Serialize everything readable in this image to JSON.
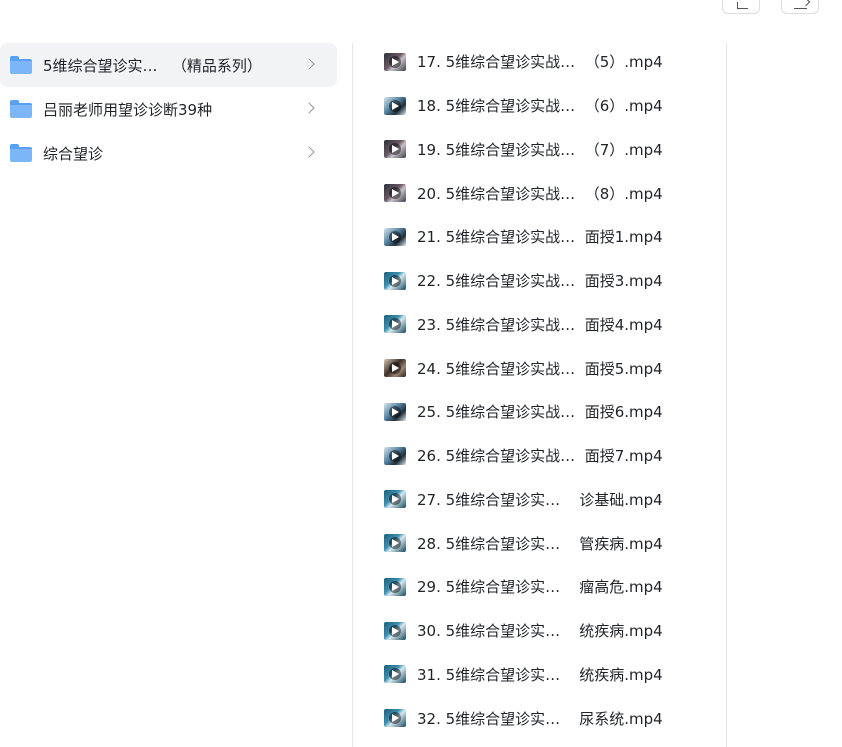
{
  "folders": [
    {
      "name": "5维综合望诊实…   （精品系列）",
      "selected": true
    },
    {
      "name": "吕丽老师用望诊诊断39种",
      "selected": false
    },
    {
      "name": "综合望诊",
      "selected": false
    }
  ],
  "files": [
    {
      "name": "17. 5维综合望诊实战…  （5）.mp4",
      "thumb": "t1"
    },
    {
      "name": "18. 5维综合望诊实战…  （6）.mp4",
      "thumb": "t2"
    },
    {
      "name": "19. 5维综合望诊实战…  （7）.mp4",
      "thumb": "t1"
    },
    {
      "name": "20. 5维综合望诊实战…  （8）.mp4",
      "thumb": "t1"
    },
    {
      "name": "21. 5维综合望诊实战…  面授1.mp4",
      "thumb": "t2"
    },
    {
      "name": "22. 5维综合望诊实战…  面授3.mp4",
      "thumb": "t3"
    },
    {
      "name": "23. 5维综合望诊实战…  面授4.mp4",
      "thumb": "t3"
    },
    {
      "name": "24. 5维综合望诊实战…  面授5.mp4",
      "thumb": "t4"
    },
    {
      "name": "25. 5维综合望诊实战…  面授6.mp4",
      "thumb": "t2"
    },
    {
      "name": "26. 5维综合望诊实战…  面授7.mp4",
      "thumb": "t2"
    },
    {
      "name": "27. 5维综合望诊实…    诊基础.mp4",
      "thumb": "t3"
    },
    {
      "name": "28. 5维综合望诊实…    管疾病.mp4",
      "thumb": "t3"
    },
    {
      "name": "29. 5维综合望诊实…    瘤高危.mp4",
      "thumb": "t3"
    },
    {
      "name": "30. 5维综合望诊实…    统疾病.mp4",
      "thumb": "t3"
    },
    {
      "name": "31. 5维综合望诊实…    统疾病.mp4",
      "thumb": "t3"
    },
    {
      "name": "32. 5维综合望诊实…    尿系统.mp4",
      "thumb": "t3"
    }
  ]
}
